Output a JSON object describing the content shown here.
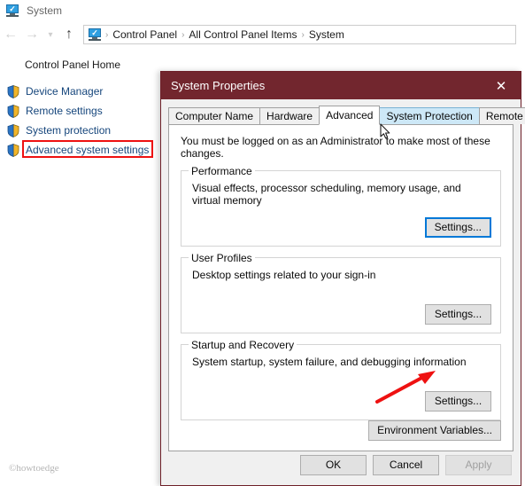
{
  "window": {
    "title": "System",
    "icon": "system-monitor-icon"
  },
  "nav": {
    "back_icon": "arrow-left-icon",
    "forward_icon": "arrow-right-icon",
    "recent_icon": "chevron-down-icon",
    "up_icon": "arrow-up-icon",
    "breadcrumb": [
      "Control Panel",
      "All Control Panel Items",
      "System"
    ],
    "separator": "›"
  },
  "sidebar": {
    "home_label": "Control Panel Home",
    "items": [
      {
        "label": "Device Manager",
        "icon": "uac-shield-icon",
        "highlighted": false
      },
      {
        "label": "Remote settings",
        "icon": "uac-shield-icon",
        "highlighted": false
      },
      {
        "label": "System protection",
        "icon": "uac-shield-icon",
        "highlighted": false
      },
      {
        "label": "Advanced system settings",
        "icon": "uac-shield-icon",
        "highlighted": true
      }
    ]
  },
  "watermark": "©howtoedge",
  "dialog": {
    "title": "System Properties",
    "close_icon": "close-icon",
    "titlebar_color": "#72262e",
    "tabs": [
      {
        "label": "Computer Name",
        "state": "normal"
      },
      {
        "label": "Hardware",
        "state": "normal"
      },
      {
        "label": "Advanced",
        "state": "active"
      },
      {
        "label": "System Protection",
        "state": "hover"
      },
      {
        "label": "Remote",
        "state": "normal"
      }
    ],
    "admin_note": "You must be logged on as an Administrator to make most of these changes.",
    "groups": [
      {
        "title": "Performance",
        "description": "Visual effects, processor scheduling, memory usage, and virtual memory",
        "button": "Settings...",
        "button_state": "focused"
      },
      {
        "title": "User Profiles",
        "description": "Desktop settings related to your sign-in",
        "button": "Settings...",
        "button_state": "normal"
      },
      {
        "title": "Startup and Recovery",
        "description": "System startup, system failure, and debugging information",
        "button": "Settings...",
        "button_state": "normal"
      }
    ],
    "environment_button": "Environment Variables...",
    "footer": {
      "ok": "OK",
      "cancel": "Cancel",
      "apply": "Apply",
      "apply_disabled": true
    }
  },
  "annotations": {
    "highlight_color": "#ee1111",
    "arrow_color": "#ee1111",
    "arrow_target": "startup-recovery-settings-button"
  }
}
